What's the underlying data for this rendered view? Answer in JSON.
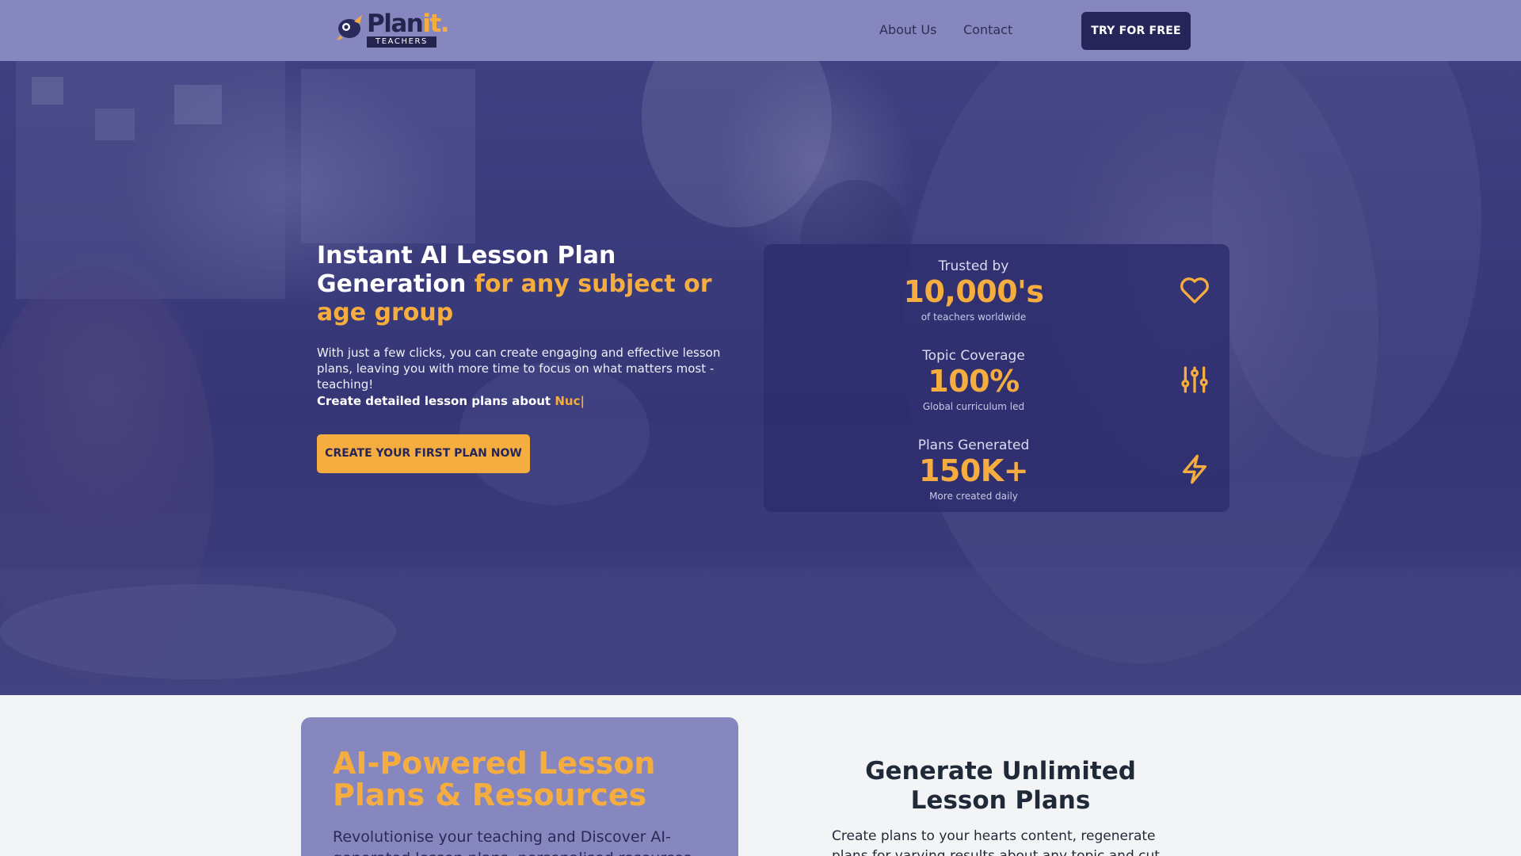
{
  "brand": {
    "name_main": "Plan",
    "name_accent": "it.",
    "sub": "TEACHERS"
  },
  "nav": {
    "about": "About Us",
    "contact": "Contact",
    "try_free": "TRY FOR FREE"
  },
  "hero": {
    "title_plain": "Instant AI Lesson Plan Generation",
    "title_highlight": "for any subject or age group",
    "description": "With just a few clicks, you can create engaging and effective lesson plans, leaving you with more time to focus on what matters most - teaching!",
    "about_prefix": "Create detailed lesson plans about",
    "about_typed": "Nuc|",
    "cta": "CREATE YOUR FIRST PLAN NOW"
  },
  "stats": [
    {
      "label": "Trusted by",
      "value": "10,000's",
      "note": "of teachers worldwide",
      "icon": "heart-icon"
    },
    {
      "label": "Topic Coverage",
      "value": "100%",
      "note": "Global curriculum led",
      "icon": "sliders-icon"
    },
    {
      "label": "Plans Generated",
      "value": "150K+",
      "note": "More created daily",
      "icon": "lightning-icon"
    }
  ],
  "feature_card": {
    "title": "AI-Powered Lesson Plans & Resources",
    "description": "Revolutionise your teaching and Discover AI-generated lesson plans, personalised resources and"
  },
  "generate": {
    "title": "Generate Unlimited Lesson Plans",
    "description": "Create plans to your hearts content, regenerate plans for varying results about any topic and cut down your"
  },
  "colors": {
    "nav_bg": "#8787c0",
    "accent": "#f6ad3f",
    "dark": "#25255a",
    "hero_overlay": "#2d2d6e"
  }
}
